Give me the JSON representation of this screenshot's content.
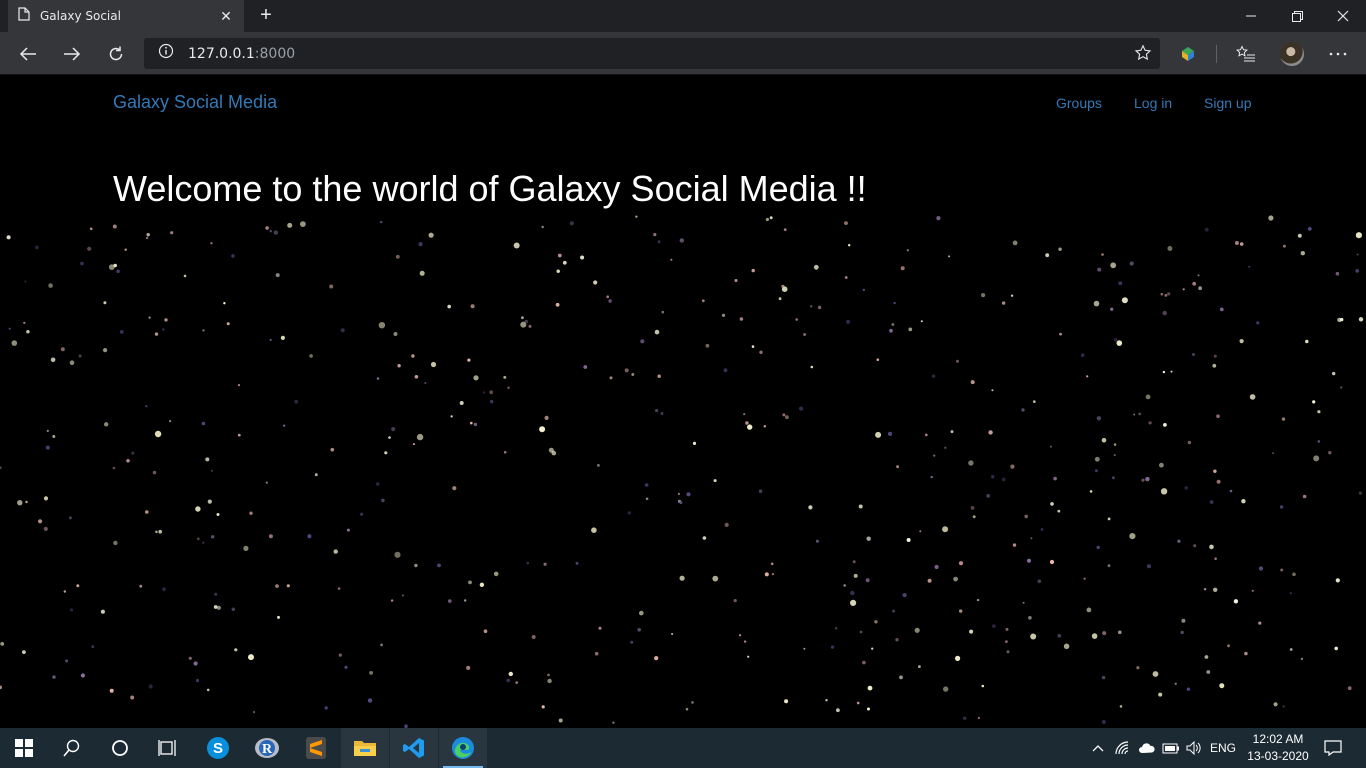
{
  "browser": {
    "tab_title": "Galaxy Social",
    "url_host": "127.0.0.1",
    "url_port": ":8000"
  },
  "page": {
    "brand": "Galaxy Social Media",
    "nav": [
      {
        "label": "Groups"
      },
      {
        "label": "Log in"
      },
      {
        "label": "Sign up"
      }
    ],
    "headline": "Welcome to the world of Galaxy Social Media !!"
  },
  "taskbar": {
    "language": "ENG",
    "time": "12:02 AM",
    "date": "13-03-2020",
    "apps": [
      "start-icon",
      "search-icon",
      "cortana-icon",
      "task-view-icon",
      "skype-icon",
      "r-icon",
      "sublime-text-icon",
      "file-explorer-icon",
      "vscode-icon",
      "edge-icon"
    ]
  },
  "colors": {
    "link": "#337ab7",
    "background": "#000000",
    "chrome_dark": "#202124",
    "chrome": "#35363a",
    "taskbar": "#1c2a33"
  }
}
